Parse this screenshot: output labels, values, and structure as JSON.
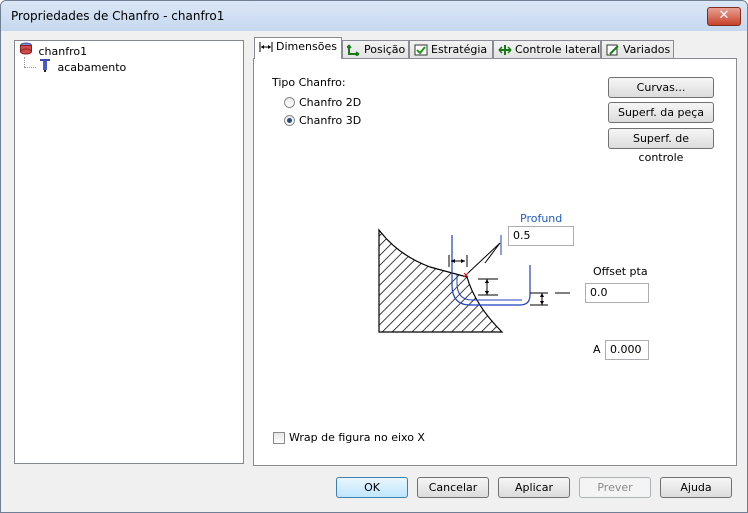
{
  "window": {
    "title": "Propriedades de Chanfro - chanfro1",
    "close_label": "✕"
  },
  "tree": {
    "root_label": "chanfro1",
    "child_label": "acabamento"
  },
  "tabs": [
    {
      "label": "Dimensões",
      "icon": "dimension-arrows-icon",
      "active": true
    },
    {
      "label": "Posição",
      "icon": "position-icon"
    },
    {
      "label": "Estratégia",
      "icon": "strategy-icon"
    },
    {
      "label": "Controle lateral",
      "icon": "lateral-control-icon"
    },
    {
      "label": "Variados",
      "icon": "misc-icon"
    }
  ],
  "dimensoes": {
    "tipo_label": "Tipo Chanfro:",
    "options": [
      {
        "label": "Chanfro 2D",
        "selected": false
      },
      {
        "label": "Chanfro 3D",
        "selected": true
      }
    ],
    "buttons": {
      "curvas": "Curvas...",
      "superf_peca": "Superf. da peça",
      "superf_controle": "Superf. de controle"
    },
    "profund_label": "Profund",
    "profund_value": "0.5",
    "offset_label": "Offset pta",
    "offset_value": "0.0",
    "a_label": "A",
    "a_value": "0.000",
    "wrap_label": "Wrap de figura no eixo X",
    "wrap_checked": false
  },
  "footer": {
    "ok": "OK",
    "cancelar": "Cancelar",
    "aplicar": "Aplicar",
    "prever": "Prever",
    "ajuda": "Ajuda"
  },
  "colors": {
    "accent_blue": "#1f3fbf",
    "profund_text": "#1e5ccc"
  }
}
